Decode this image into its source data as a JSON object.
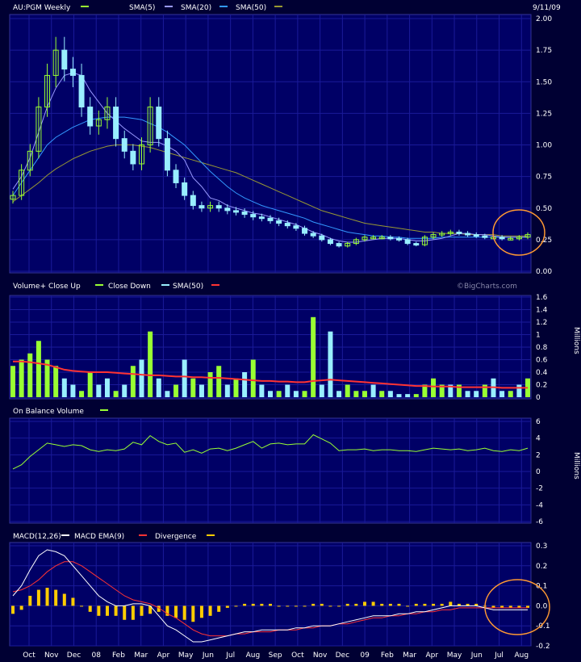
{
  "header": {
    "symbol_label": "AU:PGM Weekly",
    "date": "9/11/09",
    "watermark": "©BigCharts.com"
  },
  "colors": {
    "background": "#000033",
    "plot_bg": "#000066",
    "grid": "#1a1a99",
    "up": "#99ff33",
    "down": "#99eeff",
    "sma5": "#9999ff",
    "sma20": "#3399ff",
    "sma50": "#999933",
    "obv": "#99ff33",
    "macd": "#ffffff",
    "macd_ema": "#ff3333",
    "divergence": "#ffcc00",
    "highlight": "#ff9933"
  },
  "chart_data": [
    {
      "type": "candlestick",
      "title": "AU:PGM Weekly",
      "legend": [
        {
          "label": "SMA(5)",
          "color": "#9999ff"
        },
        {
          "label": "SMA(20)",
          "color": "#3399ff"
        },
        {
          "label": "SMA(50)",
          "color": "#999933"
        }
      ],
      "ylim": [
        0,
        2.0
      ],
      "yticks": [
        "0.00",
        "0.25",
        "0.50",
        "0.75",
        "1.00",
        "1.25",
        "1.50",
        "1.75",
        "2.00"
      ],
      "x_labels": [
        "Oct",
        "Nov",
        "Dec",
        "08",
        "Feb",
        "Mar",
        "Apr",
        "May",
        "Jun",
        "Jul",
        "Aug",
        "Sep",
        "Oct",
        "Nov",
        "Dec",
        "09",
        "Feb",
        "Mar",
        "Apr",
        "May",
        "Jun",
        "Jul",
        "Aug"
      ],
      "close": [
        0.6,
        0.8,
        0.95,
        1.3,
        1.55,
        1.75,
        1.6,
        1.55,
        1.3,
        1.15,
        1.2,
        1.3,
        1.05,
        0.95,
        0.85,
        1.0,
        1.3,
        1.05,
        0.8,
        0.7,
        0.6,
        0.52,
        0.5,
        0.52,
        0.5,
        0.48,
        0.47,
        0.45,
        0.43,
        0.42,
        0.4,
        0.38,
        0.36,
        0.34,
        0.3,
        0.28,
        0.25,
        0.22,
        0.2,
        0.22,
        0.25,
        0.27,
        0.27,
        0.27,
        0.26,
        0.25,
        0.22,
        0.21,
        0.27,
        0.29,
        0.3,
        0.31,
        0.3,
        0.29,
        0.28,
        0.27,
        0.27,
        0.26,
        0.26,
        0.27,
        0.29
      ],
      "sma5": [
        0.65,
        0.75,
        0.9,
        1.1,
        1.3,
        1.45,
        1.55,
        1.57,
        1.55,
        1.43,
        1.34,
        1.25,
        1.19,
        1.13,
        1.08,
        1.03,
        1.02,
        1.02,
        0.99,
        0.95,
        0.88,
        0.74,
        0.67,
        0.58,
        0.56,
        0.52,
        0.5,
        0.48,
        0.46,
        0.45,
        0.43,
        0.41,
        0.39,
        0.37,
        0.34,
        0.31,
        0.29,
        0.26,
        0.24,
        0.23,
        0.23,
        0.24,
        0.25,
        0.26,
        0.26,
        0.26,
        0.25,
        0.24,
        0.24,
        0.25,
        0.26,
        0.28,
        0.3,
        0.3,
        0.29,
        0.29,
        0.28,
        0.27,
        0.27,
        0.27,
        0.27
      ],
      "sma20": [
        0.6,
        0.7,
        0.8,
        0.9,
        1.0,
        1.06,
        1.1,
        1.14,
        1.17,
        1.2,
        1.21,
        1.22,
        1.22,
        1.22,
        1.21,
        1.2,
        1.17,
        1.14,
        1.1,
        1.05,
        1.0,
        0.93,
        0.86,
        0.79,
        0.73,
        0.67,
        0.62,
        0.58,
        0.55,
        0.52,
        0.5,
        0.48,
        0.46,
        0.44,
        0.42,
        0.39,
        0.37,
        0.35,
        0.33,
        0.31,
        0.3,
        0.29,
        0.28,
        0.28,
        0.27,
        0.27,
        0.26,
        0.26,
        0.26,
        0.26,
        0.27,
        0.27,
        0.27,
        0.27,
        0.27,
        0.27,
        0.27,
        0.27,
        0.27,
        0.27,
        0.27
      ],
      "sma50": [
        0.55,
        0.6,
        0.65,
        0.7,
        0.76,
        0.81,
        0.85,
        0.89,
        0.92,
        0.95,
        0.97,
        0.99,
        1.0,
        1.0,
        1.0,
        0.99,
        0.98,
        0.96,
        0.94,
        0.92,
        0.9,
        0.88,
        0.86,
        0.84,
        0.82,
        0.8,
        0.78,
        0.75,
        0.72,
        0.69,
        0.66,
        0.63,
        0.6,
        0.57,
        0.54,
        0.51,
        0.48,
        0.46,
        0.44,
        0.42,
        0.4,
        0.38,
        0.37,
        0.36,
        0.35,
        0.34,
        0.33,
        0.32,
        0.31,
        0.31,
        0.3,
        0.3,
        0.3,
        0.29,
        0.29,
        0.29,
        0.29,
        0.28,
        0.28,
        0.28,
        0.28
      ]
    },
    {
      "type": "bar",
      "title": "Volume",
      "legend": [
        {
          "label": "Volume+",
          "color": "#ffffff"
        },
        {
          "label": "Close Up",
          "color": "#99ff33"
        },
        {
          "label": "Close Down",
          "color": "#99eeff"
        },
        {
          "label": "SMA(50)",
          "color": "#ff3333"
        }
      ],
      "ylabel": "Millions",
      "ylim": [
        0,
        1.6
      ],
      "yticks": [
        "0",
        "0.2",
        "0.4",
        "0.6",
        "0.8",
        "1",
        "1.2",
        "1.4",
        "1.6"
      ],
      "values": [
        0.5,
        0.6,
        0.7,
        0.9,
        0.6,
        0.5,
        0.3,
        0.2,
        0.1,
        0.4,
        0.2,
        0.3,
        0.1,
        0.2,
        0.5,
        0.6,
        1.05,
        0.3,
        0.1,
        0.2,
        0.6,
        0.3,
        0.2,
        0.4,
        0.5,
        0.2,
        0.3,
        0.4,
        0.6,
        0.2,
        0.1,
        0.1,
        0.2,
        0.1,
        0.1,
        1.28,
        0.2,
        1.05,
        0.1,
        0.2,
        0.1,
        0.1,
        0.2,
        0.1,
        0.1,
        0.05,
        0.05,
        0.05,
        0.2,
        0.3,
        0.2,
        0.2,
        0.2,
        0.1,
        0.1,
        0.2,
        0.3,
        0.1,
        0.1,
        0.2,
        0.3
      ],
      "up": [
        1,
        1,
        1,
        1,
        1,
        1,
        0,
        0,
        1,
        1,
        0,
        0,
        1,
        0,
        1,
        0,
        1,
        0,
        0,
        1,
        0,
        1,
        0,
        1,
        1,
        0,
        1,
        0,
        1,
        0,
        0,
        1,
        0,
        0,
        1,
        1,
        0,
        0,
        0,
        1,
        1,
        1,
        0,
        1,
        0,
        0,
        0,
        1,
        1,
        1,
        1,
        0,
        1,
        0,
        0,
        1,
        0,
        0,
        1,
        0,
        1
      ],
      "sma50": [
        0.57,
        0.57,
        0.56,
        0.54,
        0.52,
        0.48,
        0.44,
        0.42,
        0.41,
        0.4,
        0.4,
        0.4,
        0.39,
        0.38,
        0.37,
        0.36,
        0.35,
        0.35,
        0.34,
        0.33,
        0.33,
        0.32,
        0.32,
        0.31,
        0.31,
        0.3,
        0.29,
        0.28,
        0.27,
        0.26,
        0.26,
        0.25,
        0.25,
        0.24,
        0.24,
        0.26,
        0.27,
        0.28,
        0.27,
        0.26,
        0.25,
        0.24,
        0.23,
        0.22,
        0.21,
        0.2,
        0.19,
        0.18,
        0.18,
        0.17,
        0.17,
        0.17,
        0.16,
        0.16,
        0.16,
        0.16,
        0.16,
        0.15,
        0.15,
        0.15,
        0.15
      ]
    },
    {
      "type": "line",
      "title": "On Balance Volume",
      "legend": [
        {
          "label": "On Balance Volume",
          "color": "#99ff33"
        }
      ],
      "ylabel": "Millions",
      "ylim": [
        -6,
        6
      ],
      "yticks": [
        "-6",
        "-4",
        "-2",
        "0",
        "2",
        "4",
        "6"
      ],
      "values": [
        0.3,
        0.8,
        1.8,
        2.6,
        3.4,
        3.2,
        3.0,
        3.2,
        3.1,
        2.6,
        2.4,
        2.6,
        2.5,
        2.7,
        3.5,
        3.2,
        4.3,
        3.6,
        3.2,
        3.4,
        2.3,
        2.6,
        2.2,
        2.7,
        2.8,
        2.5,
        2.8,
        3.2,
        3.6,
        2.8,
        3.3,
        3.4,
        3.2,
        3.3,
        3.3,
        4.4,
        3.9,
        3.4,
        2.5,
        2.6,
        2.6,
        2.7,
        2.5,
        2.6,
        2.6,
        2.5,
        2.5,
        2.4,
        2.6,
        2.8,
        2.7,
        2.6,
        2.7,
        2.5,
        2.6,
        2.8,
        2.5,
        2.4,
        2.6,
        2.5,
        2.8
      ]
    },
    {
      "type": "line",
      "title": "MACD",
      "legend": [
        {
          "label": "MACD(12,26)",
          "color": "#ffffff"
        },
        {
          "label": "MACD EMA(9)",
          "color": "#ff3333"
        },
        {
          "label": "Divergence",
          "color": "#ffcc00"
        }
      ],
      "ylim": [
        -0.2,
        0.3
      ],
      "yticks": [
        "-0.2",
        "-0.1",
        "0.0",
        "0.1",
        "0.2",
        "0.3"
      ],
      "macd": [
        0.05,
        0.1,
        0.18,
        0.25,
        0.28,
        0.27,
        0.25,
        0.2,
        0.15,
        0.1,
        0.05,
        0.02,
        0.0,
        0.0,
        0.01,
        0.01,
        0.0,
        -0.05,
        -0.1,
        -0.12,
        -0.15,
        -0.18,
        -0.18,
        -0.17,
        -0.16,
        -0.15,
        -0.14,
        -0.13,
        -0.13,
        -0.12,
        -0.12,
        -0.12,
        -0.12,
        -0.11,
        -0.11,
        -0.1,
        -0.1,
        -0.1,
        -0.09,
        -0.08,
        -0.07,
        -0.06,
        -0.05,
        -0.05,
        -0.05,
        -0.04,
        -0.04,
        -0.03,
        -0.03,
        -0.02,
        -0.01,
        0.0,
        0.0,
        0.0,
        0.0,
        -0.01,
        -0.02,
        -0.02,
        -0.02,
        -0.02,
        -0.02
      ],
      "ema": [
        0.07,
        0.08,
        0.1,
        0.13,
        0.17,
        0.2,
        0.22,
        0.22,
        0.2,
        0.17,
        0.14,
        0.11,
        0.08,
        0.05,
        0.03,
        0.02,
        0.01,
        -0.01,
        -0.04,
        -0.06,
        -0.09,
        -0.12,
        -0.14,
        -0.15,
        -0.15,
        -0.15,
        -0.14,
        -0.14,
        -0.13,
        -0.13,
        -0.13,
        -0.12,
        -0.12,
        -0.12,
        -0.11,
        -0.11,
        -0.1,
        -0.1,
        -0.09,
        -0.09,
        -0.08,
        -0.07,
        -0.06,
        -0.06,
        -0.05,
        -0.05,
        -0.04,
        -0.04,
        -0.03,
        -0.03,
        -0.02,
        -0.02,
        -0.01,
        -0.01,
        -0.01,
        -0.01,
        -0.01,
        -0.01,
        -0.01,
        -0.01,
        -0.01
      ],
      "divergence": [
        -0.04,
        -0.02,
        0.05,
        0.08,
        0.09,
        0.08,
        0.06,
        0.04,
        0.0,
        -0.03,
        -0.05,
        -0.05,
        -0.05,
        -0.07,
        -0.07,
        -0.05,
        -0.04,
        -0.03,
        -0.05,
        -0.06,
        -0.07,
        -0.08,
        -0.06,
        -0.05,
        -0.03,
        -0.01,
        0.0,
        0.01,
        0.01,
        0.01,
        0.01,
        0.0,
        0.0,
        0.0,
        0.0,
        0.01,
        0.01,
        0.0,
        0.0,
        0.01,
        0.01,
        0.02,
        0.02,
        0.01,
        0.01,
        0.01,
        0.0,
        0.01,
        0.01,
        0.01,
        0.01,
        0.02,
        0.01,
        0.01,
        0.01,
        0.0,
        -0.01,
        -0.01,
        -0.01,
        -0.01,
        -0.01
      ]
    }
  ]
}
